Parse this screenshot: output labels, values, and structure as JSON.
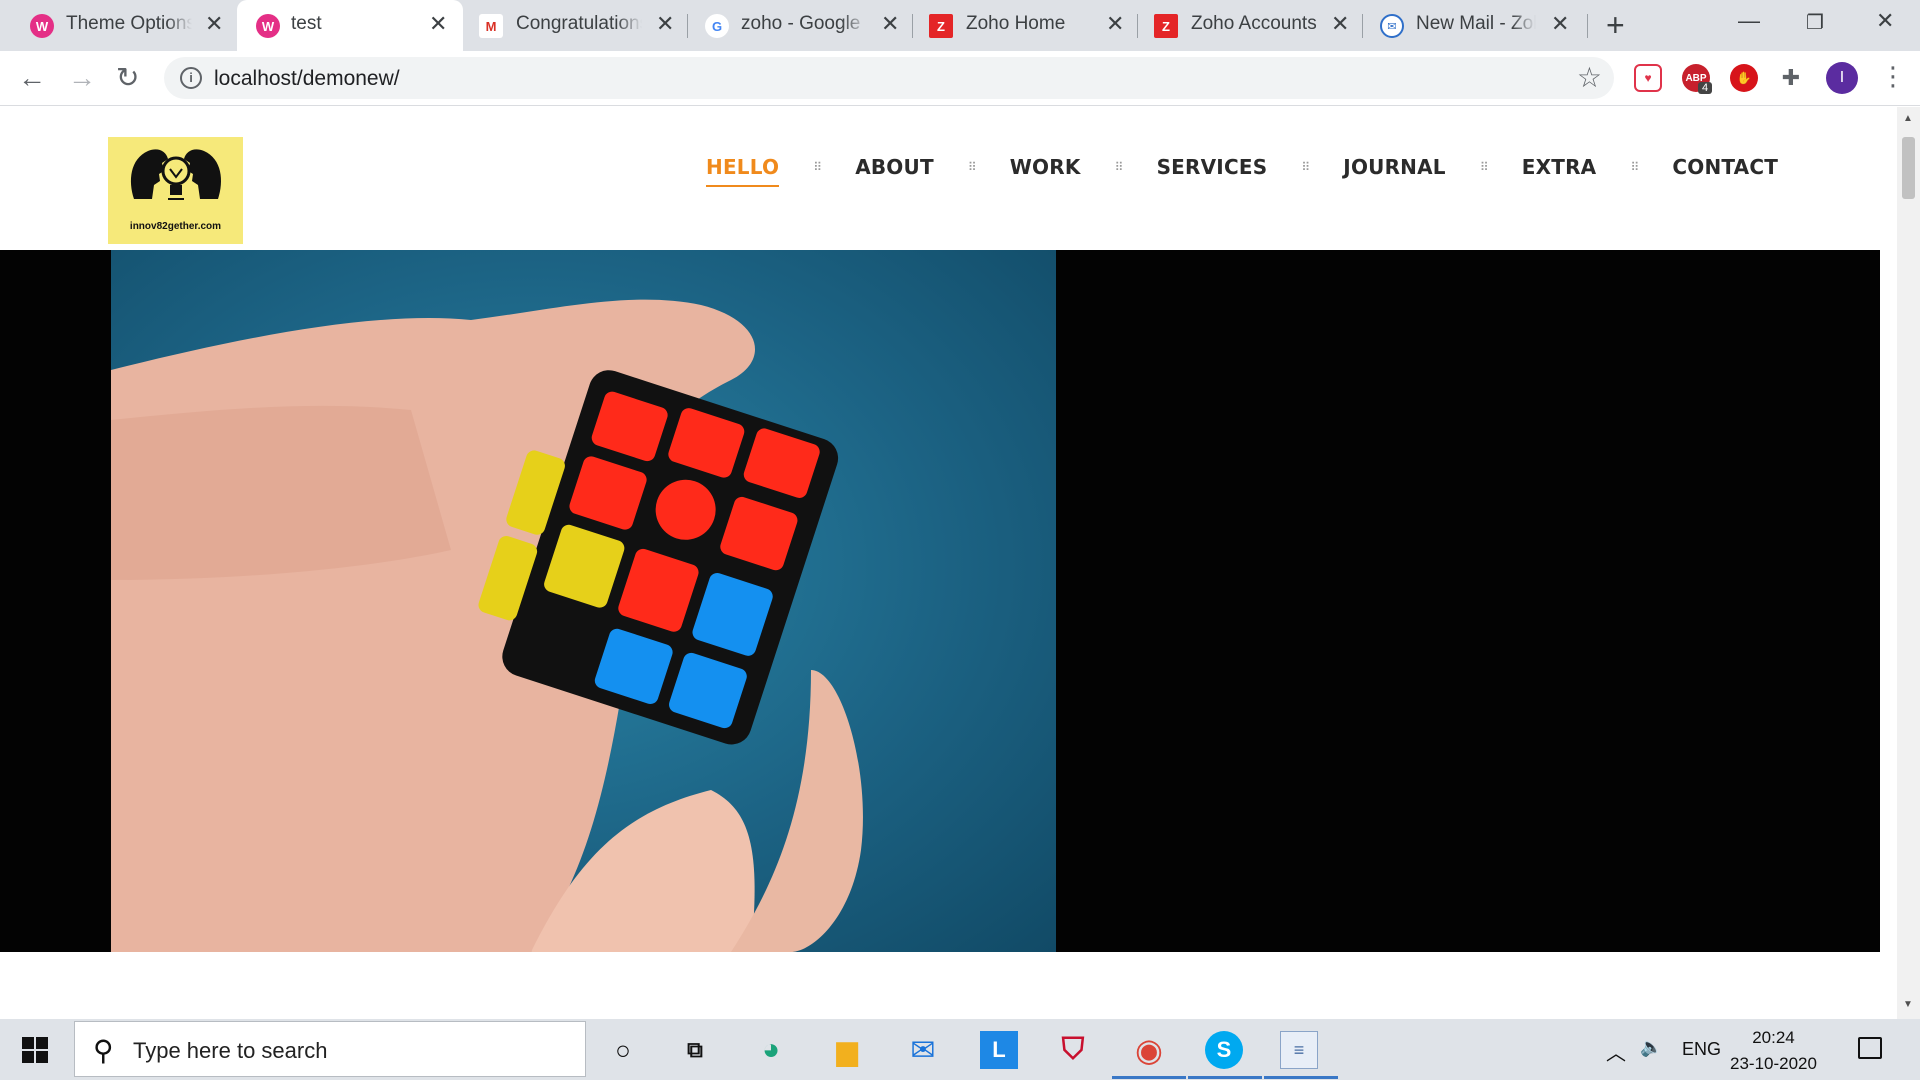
{
  "browser": {
    "tabs": [
      {
        "title": "Theme Options",
        "icon": "wordpress-icon",
        "active": false
      },
      {
        "title": "test",
        "icon": "wordpress-icon",
        "active": true
      },
      {
        "title": "Congratulations",
        "icon": "gmail-icon",
        "active": false
      },
      {
        "title": "zoho - Google S",
        "icon": "google-icon",
        "active": false
      },
      {
        "title": "Zoho Home",
        "icon": "zoho-icon",
        "active": false
      },
      {
        "title": "Zoho Accounts",
        "icon": "zoho-icon",
        "active": false
      },
      {
        "title": "New Mail - Zoho",
        "icon": "zoho-mail-icon",
        "active": false
      }
    ],
    "url": "localhost/demonew/",
    "extensions": [
      {
        "name": "pocket-extension-icon",
        "color": "#e0334a"
      },
      {
        "name": "adblock-extension-icon",
        "label": "ABP",
        "badge": "4",
        "color": "#c7202c"
      },
      {
        "name": "stop-extension-icon",
        "color": "#d7141a"
      },
      {
        "name": "extensions-puzzle-icon",
        "color": "#5f6368"
      }
    ],
    "profile_initial": "I"
  },
  "site": {
    "logo_text": "innov82gether.com",
    "nav": [
      {
        "label": "HELLO",
        "active": true
      },
      {
        "label": "ABOUT",
        "active": false
      },
      {
        "label": "WORK",
        "active": false
      },
      {
        "label": "SERVICES",
        "active": false
      },
      {
        "label": "JOURNAL",
        "active": false
      },
      {
        "label": "EXTRA",
        "active": false
      },
      {
        "label": "CONTACT",
        "active": false
      }
    ],
    "accent_color": "#f08a1c",
    "hero_image": "hands-solving-rubiks-cube"
  },
  "taskbar": {
    "search_placeholder": "Type here to search",
    "apps": [
      "cortana-icon",
      "task-view-icon",
      "edge-icon",
      "file-explorer-icon",
      "mail-icon",
      "l-app-icon",
      "mcafee-icon",
      "chrome-icon",
      "skype-icon",
      "notepad-app-icon"
    ],
    "language": "ENG",
    "time": "20:24",
    "date": "23-10-2020"
  }
}
